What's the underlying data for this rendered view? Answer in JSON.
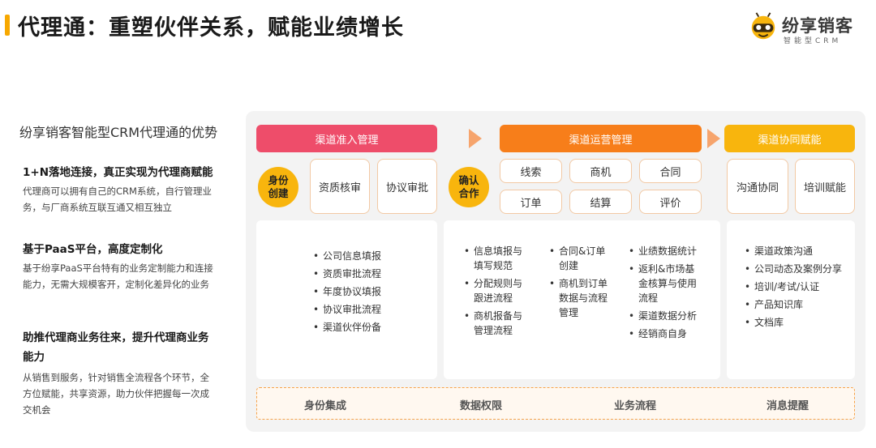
{
  "header": {
    "title": "代理通：重塑伙伴关系，赋能业绩增长",
    "logo_name": "纷享销客",
    "logo_sub": "智能型CRM"
  },
  "advantages": {
    "title": "纷享销客智能型CRM代理通的优势",
    "items": [
      {
        "heading_lines": [
          "1+N落地连接，真正实现为代理商赋能"
        ],
        "body_lines": [
          "代理商可以拥有自己的CRM系统，自行管理业",
          "务，与厂商系统互联互通又相互独立"
        ]
      },
      {
        "heading_lines": [
          "基于PaaS平台，高度定制化"
        ],
        "body_lines": [
          "基于纷享PaaS平台特有的业务定制能力和连接",
          "能力，无需大规模客开，定制化差异化的业务"
        ]
      },
      {
        "heading_lines": [
          "助推代理商业务往来，提升代理商业务",
          "能力"
        ],
        "body_lines": [
          "从销售到服务，针对销售全流程各个环节，全",
          "方位赋能，共享资源，助力伙伴把握每一次成",
          "交机会"
        ]
      }
    ]
  },
  "diagram": {
    "sections": [
      {
        "header": "渠道准入管理",
        "circle_lines": [
          "身份",
          "创建"
        ],
        "boxes": [
          "资质核审",
          "协议审批"
        ],
        "detail_items": [
          "公司信息填报",
          "资质审批流程",
          "年度协议填报",
          "协议审批流程",
          "渠道伙伴份备"
        ]
      },
      {
        "header": "渠道运营管理",
        "circle_lines": [
          "确认",
          "合作"
        ],
        "grid": [
          "线索",
          "商机",
          "合同",
          "订单",
          "结算",
          "评价"
        ],
        "detail_columns": [
          [
            {
              "lines": [
                "信息填报与",
                "填写规范"
              ]
            },
            {
              "lines": [
                "分配规则与",
                "跟进流程"
              ]
            },
            {
              "lines": [
                "商机报备与",
                "管理流程"
              ]
            }
          ],
          [
            {
              "lines": [
                "合同&订单",
                "创建"
              ]
            },
            {
              "lines": [
                "商机到订单",
                "数据与流程",
                "管理"
              ]
            }
          ],
          [
            {
              "lines": [
                "业绩数据统计"
              ]
            },
            {
              "lines": [
                "返利&市场基",
                "金核算与使用",
                "流程"
              ]
            },
            {
              "lines": [
                "渠道数据分析"
              ]
            },
            {
              "lines": [
                "经销商自身"
              ]
            }
          ]
        ]
      },
      {
        "header": "渠道协同赋能",
        "boxes": [
          "沟通协同",
          "培训赋能"
        ],
        "detail_items": [
          "渠道政策沟通",
          "公司动态及案例分享",
          "培训/考试/认证",
          "产品知识库",
          "文档库"
        ]
      }
    ],
    "foundation": [
      "身份集成",
      "数据权限",
      "业务流程",
      "消息提醒"
    ]
  }
}
